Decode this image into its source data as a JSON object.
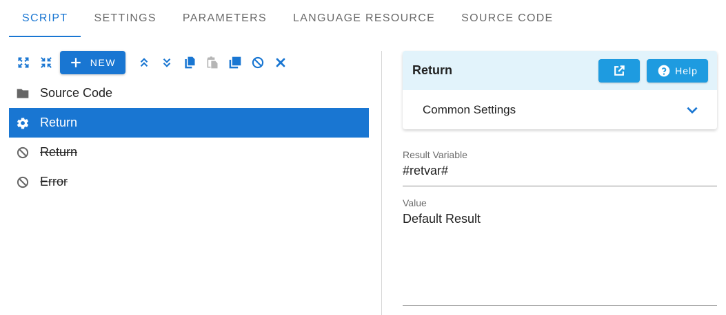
{
  "tabs": [
    {
      "label": "SCRIPT",
      "active": true
    },
    {
      "label": "SETTINGS",
      "active": false
    },
    {
      "label": "PARAMETERS",
      "active": false
    },
    {
      "label": "LANGUAGE RESOURCE",
      "active": false
    },
    {
      "label": "SOURCE CODE",
      "active": false
    }
  ],
  "toolbar": {
    "new_label": "NEW",
    "icons": [
      "expand-icon",
      "collapse-icon",
      "plus-icon",
      "move-up-icon",
      "move-down-icon",
      "copy-icon",
      "paste-icon",
      "duplicate-icon",
      "disable-icon",
      "delete-icon"
    ]
  },
  "tree": [
    {
      "label": "Source Code",
      "icon": "folder-icon",
      "selected": false,
      "disabled": false
    },
    {
      "label": "Return",
      "icon": "gear-icon",
      "selected": true,
      "disabled": false
    },
    {
      "label": "Return",
      "icon": "block-icon",
      "selected": false,
      "disabled": true
    },
    {
      "label": "Error",
      "icon": "block-icon",
      "selected": false,
      "disabled": true
    }
  ],
  "panel": {
    "title": "Return",
    "help_label": "Help",
    "common_settings_label": "Common Settings",
    "result_variable_label": "Result Variable",
    "result_variable_value": "#retvar#",
    "value_label": "Value",
    "value_value": "Default Result"
  },
  "colors": {
    "accent": "#1976d2",
    "panel_header_bg": "#e2f3fb",
    "panel_button": "#1e9be0",
    "tab_inactive": "#6b6b6b"
  }
}
